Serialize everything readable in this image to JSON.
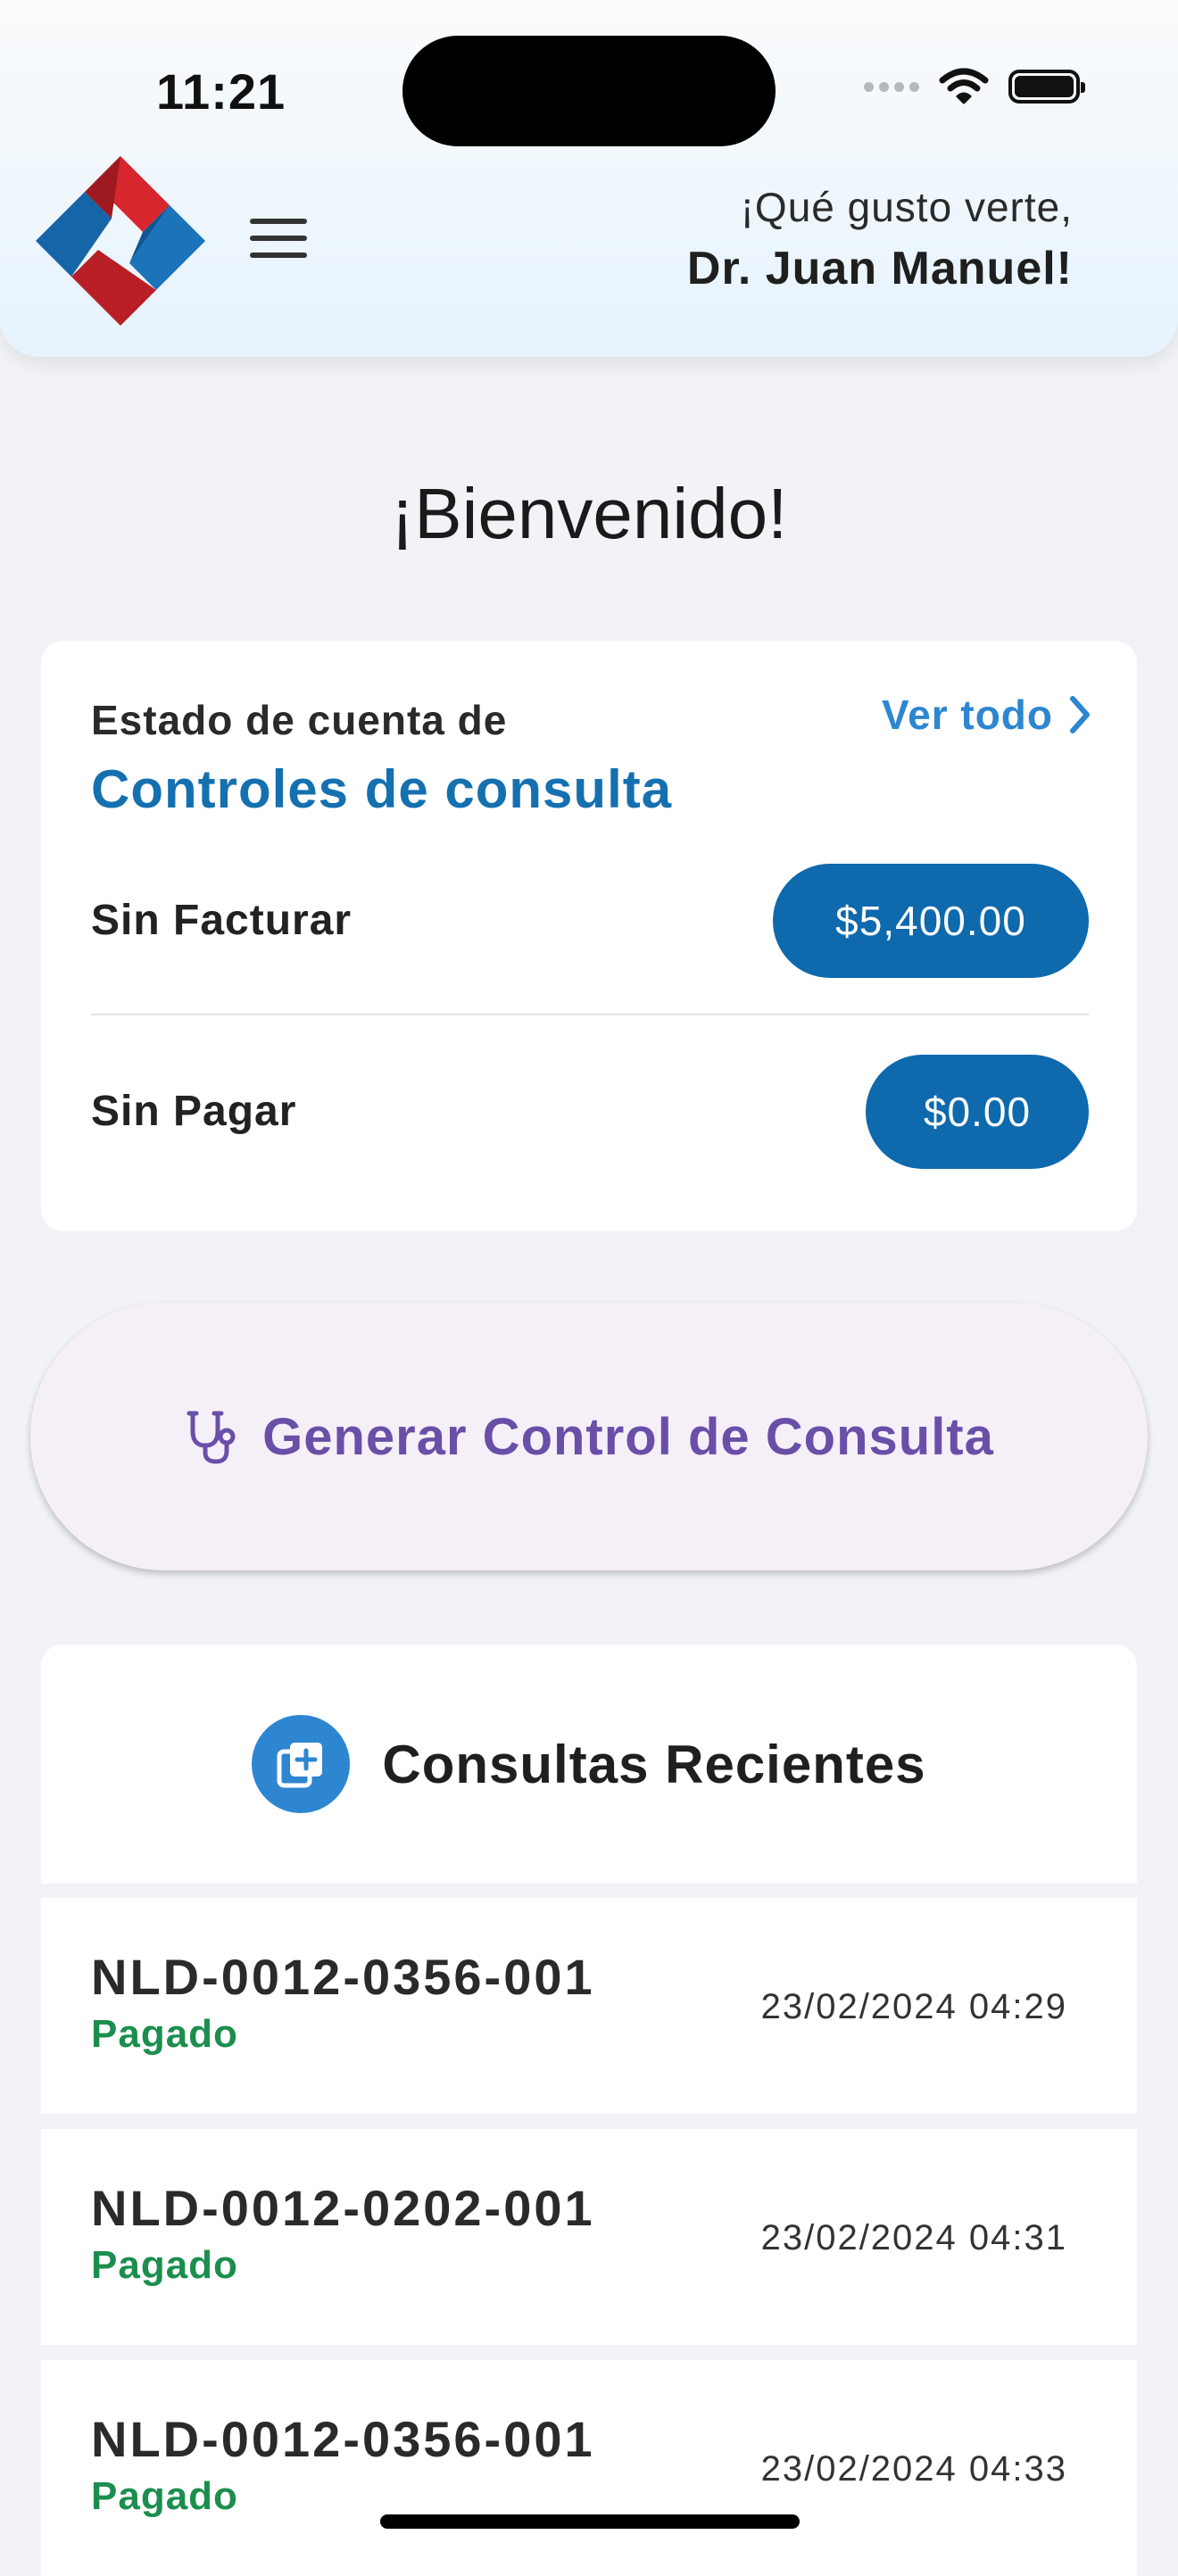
{
  "status_bar": {
    "time": "11:21"
  },
  "header": {
    "greeting": "¡Qué gusto verte,",
    "user_name": "Dr. Juan Manuel!"
  },
  "welcome": {
    "title": "¡Bienvenido!"
  },
  "account": {
    "label": "Estado de cuenta de",
    "heading": "Controles de consulta",
    "see_all": "Ver todo",
    "rows": [
      {
        "label": "Sin Facturar",
        "amount": "$5,400.00"
      },
      {
        "label": "Sin Pagar",
        "amount": "$0.00"
      }
    ]
  },
  "generate_button": {
    "label": "Generar Control de Consulta"
  },
  "recent": {
    "title": "Consultas Recientes",
    "items": [
      {
        "code": "NLD-0012-0356-001",
        "status": "Pagado",
        "date": "23/02/2024 04:29"
      },
      {
        "code": "NLD-0012-0202-001",
        "status": "Pagado",
        "date": "23/02/2024 04:31"
      },
      {
        "code": "NLD-0012-0356-001",
        "status": "Pagado",
        "date": "23/02/2024 04:33"
      }
    ]
  },
  "colors": {
    "primary": "#0E69AD",
    "link": "#2E86D0",
    "accent_purple": "#6A4FA8",
    "paid_green": "#1B8E4E",
    "logo_red": "#D7262E",
    "logo_blue": "#1B73BA"
  },
  "icons": {
    "menu": "hamburger-icon",
    "see_all": "chevron-right-icon",
    "generate": "stethoscope-icon",
    "recent": "medical-file-plus-icon"
  }
}
